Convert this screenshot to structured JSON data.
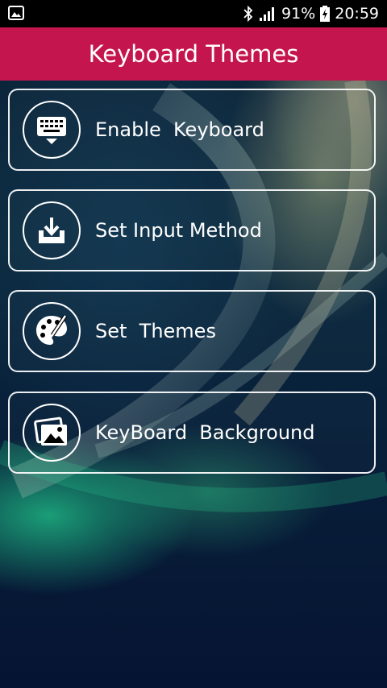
{
  "status_bar": {
    "battery": "91%",
    "time": "20:59"
  },
  "app_bar": {
    "title": "Keyboard Themes"
  },
  "menu": [
    {
      "label": "Enable  Keyboard",
      "icon": "keyboard-icon"
    },
    {
      "label": "Set Input Method",
      "icon": "download-tray-icon"
    },
    {
      "label": "Set  Themes",
      "icon": "palette-icon"
    },
    {
      "label": "KeyBoard  Background",
      "icon": "image-gallery-icon"
    }
  ],
  "colors": {
    "app_bar": "#c4154f",
    "status_bar": "#000000",
    "text": "#ffffff"
  }
}
